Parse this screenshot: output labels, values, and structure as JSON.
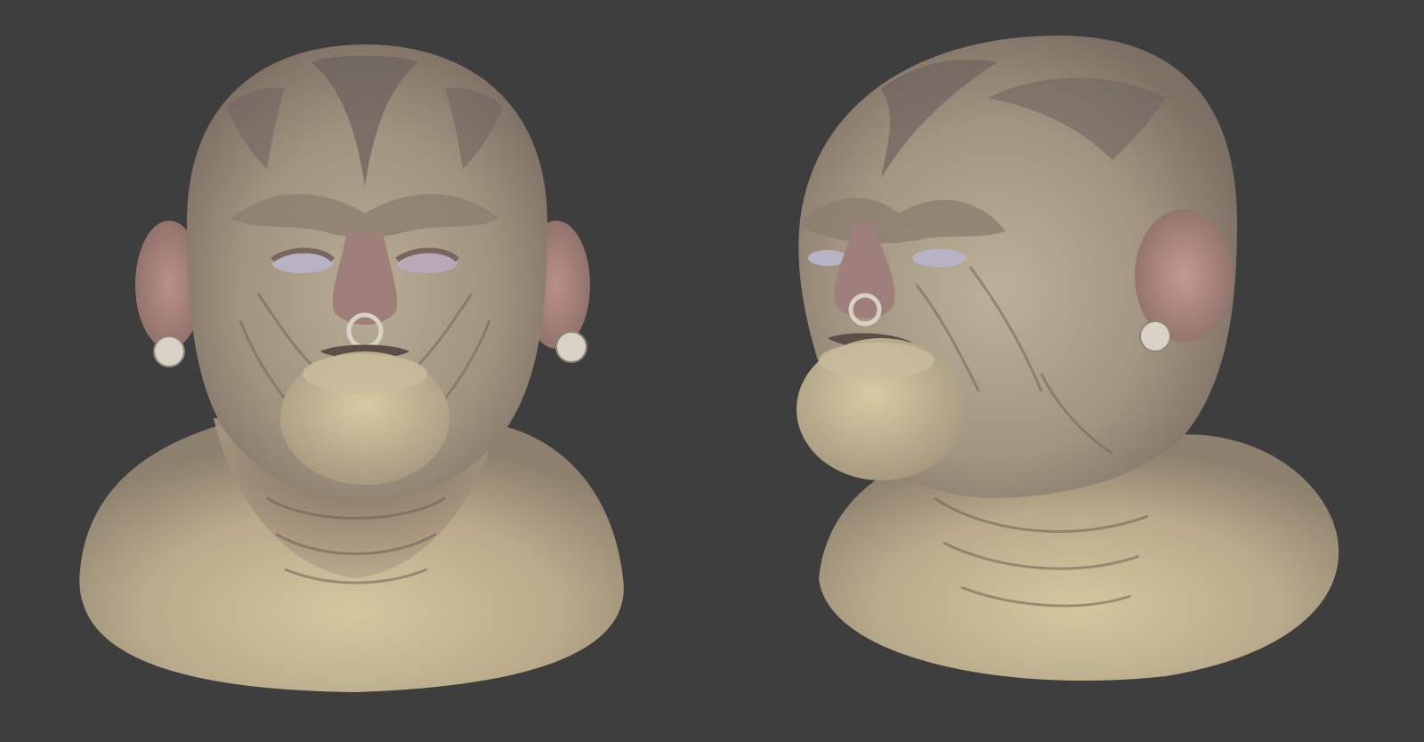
{
  "scene": {
    "background_color": "#3e3e3e",
    "views": [
      {
        "name": "front",
        "description_icon": "sculpt-bust-front"
      },
      {
        "name": "three-quarter",
        "description_icon": "sculpt-bust-side"
      }
    ]
  },
  "colors": {
    "skin_light": "#c9bf9c",
    "skin_mid": "#a89a86",
    "skin_dark": "#6f625c",
    "skin_pink": "#a9867f",
    "hair_shadow": "#6d625f",
    "jewelry": "#d9d2c4"
  }
}
